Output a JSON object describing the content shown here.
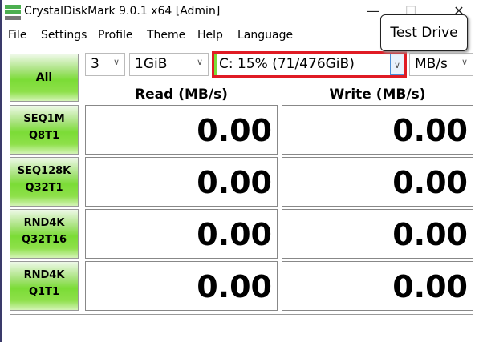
{
  "window": {
    "title": "CrystalDiskMark 9.0.1 x64 [Admin]",
    "minimize": "—",
    "maximize": "☐",
    "close": "✕"
  },
  "menu": [
    "File",
    "Settings",
    "Profile",
    "Theme",
    "Help",
    "Language"
  ],
  "controls": {
    "all_label": "All",
    "count": "3",
    "size": "1GiB",
    "drive": "C: 15% (71/476GiB)",
    "unit": "MB/s"
  },
  "tooltip": "Test Drive",
  "headers": {
    "read": "Read (MB/s)",
    "write": "Write (MB/s)"
  },
  "tests": [
    {
      "line1": "SEQ1M",
      "line2": "Q8T1",
      "read": "0.00",
      "write": "0.00"
    },
    {
      "line1": "SEQ128K",
      "line2": "Q32T1",
      "read": "0.00",
      "write": "0.00"
    },
    {
      "line1": "RND4K",
      "line2": "Q32T16",
      "read": "0.00",
      "write": "0.00"
    },
    {
      "line1": "RND4K",
      "line2": "Q1T1",
      "read": "0.00",
      "write": "0.00"
    }
  ],
  "colors": {
    "highlight": "#e01b24",
    "accent_green": "#7bdc36"
  }
}
